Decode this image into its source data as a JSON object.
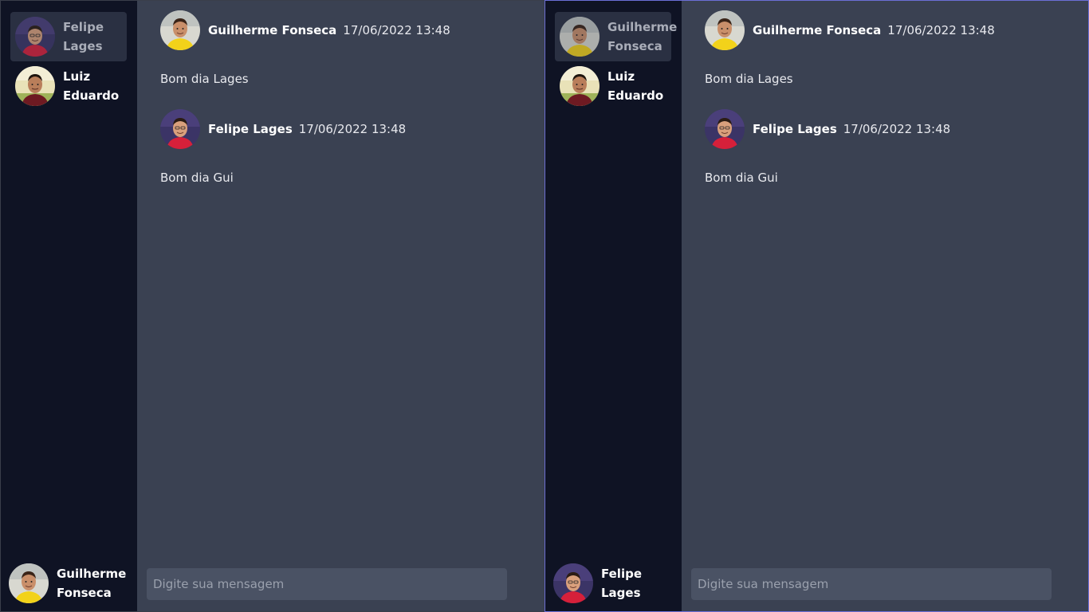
{
  "panes": [
    {
      "contacts": [
        {
          "name": "Felipe Lages",
          "active": true
        },
        {
          "name": "Luiz Eduardo",
          "active": false
        }
      ],
      "current_user": "Guilherme Fonseca",
      "messages": [
        {
          "author": "Guilherme Fonseca",
          "time": "17/06/2022 13:48",
          "text": "Bom dia Lages"
        },
        {
          "author": "Felipe Lages",
          "time": "17/06/2022 13:48",
          "text": "Bom dia Gui"
        }
      ],
      "composer_placeholder": "Digite sua mensagem"
    },
    {
      "contacts": [
        {
          "name": "Guilherme Fonseca",
          "active": true
        },
        {
          "name": "Luiz Eduardo",
          "active": false
        }
      ],
      "current_user": "Felipe Lages",
      "messages": [
        {
          "author": "Guilherme Fonseca",
          "time": "17/06/2022 13:48",
          "text": "Bom dia Lages"
        },
        {
          "author": "Felipe Lages",
          "time": "17/06/2022 13:48",
          "text": "Bom dia Gui"
        }
      ],
      "composer_placeholder": "Digite sua mensagem"
    }
  ],
  "colors": {
    "sidebar_bg": "#0f1324",
    "chat_bg": "#3a4152",
    "active_contact_bg": "#2a3042",
    "input_bg": "#4a5264",
    "focus_border": "#6b6fd6"
  }
}
